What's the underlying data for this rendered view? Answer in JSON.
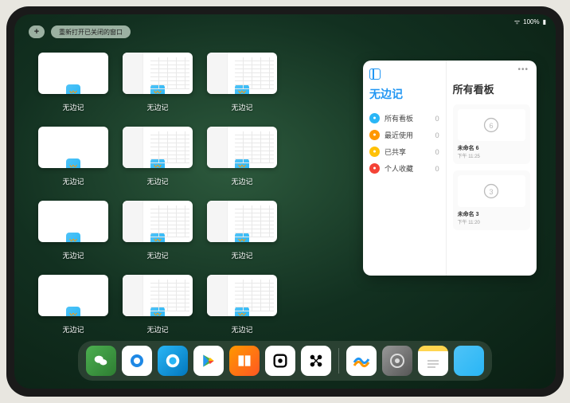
{
  "status": {
    "battery": "100%"
  },
  "top": {
    "plus": "+",
    "reopen": "重新打开已关闭的窗口"
  },
  "app_name": "无边记",
  "windows": [
    {
      "label": "无边记",
      "type": "blank"
    },
    {
      "label": "无边记",
      "type": "detailed"
    },
    {
      "label": "无边记",
      "type": "detailed"
    },
    {
      "label": "无边记",
      "type": "blank"
    },
    {
      "label": "无边记",
      "type": "detailed"
    },
    {
      "label": "无边记",
      "type": "detailed"
    },
    {
      "label": "无边记",
      "type": "blank"
    },
    {
      "label": "无边记",
      "type": "detailed"
    },
    {
      "label": "无边记",
      "type": "detailed"
    },
    {
      "label": "无边记",
      "type": "blank"
    },
    {
      "label": "无边记",
      "type": "detailed"
    },
    {
      "label": "无边记",
      "type": "detailed"
    }
  ],
  "panel": {
    "title": "无边记",
    "right_title": "所有看板",
    "categories": [
      {
        "icon_color": "#29b6f6",
        "label": "所有看板",
        "count": "0"
      },
      {
        "icon_color": "#ff9800",
        "label": "最近使用",
        "count": "0"
      },
      {
        "icon_color": "#ffc107",
        "label": "已共享",
        "count": "0"
      },
      {
        "icon_color": "#f44336",
        "label": "个人收藏",
        "count": "0"
      }
    ],
    "boards": [
      {
        "name": "未命名 6",
        "sub": "下午 11:25",
        "digit": "6"
      },
      {
        "name": "未命名 3",
        "sub": "下午 11:20",
        "digit": "3"
      }
    ]
  },
  "dock": {
    "items": [
      {
        "name": "wechat",
        "class": "di-wechat"
      },
      {
        "name": "qq",
        "class": "di-qq"
      },
      {
        "name": "browser",
        "class": "di-browser"
      },
      {
        "name": "play",
        "class": "di-play"
      },
      {
        "name": "books",
        "class": "di-books"
      },
      {
        "name": "widget",
        "class": "di-widget"
      },
      {
        "name": "connect",
        "class": "di-connect"
      }
    ],
    "recent": [
      {
        "name": "freeform",
        "class": "di-freeform"
      },
      {
        "name": "settings",
        "class": "di-settings"
      },
      {
        "name": "notes",
        "class": "di-notes"
      },
      {
        "name": "app-library",
        "class": "di-folder"
      }
    ]
  }
}
